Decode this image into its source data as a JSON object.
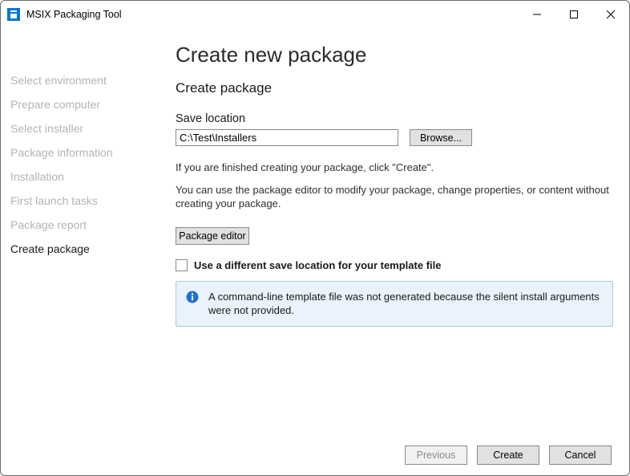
{
  "app": {
    "title": "MSIX Packaging Tool"
  },
  "sidebar": {
    "items": [
      {
        "label": "Select environment"
      },
      {
        "label": "Prepare computer"
      },
      {
        "label": "Select installer"
      },
      {
        "label": "Package information"
      },
      {
        "label": "Installation"
      },
      {
        "label": "First launch tasks"
      },
      {
        "label": "Package report"
      },
      {
        "label": "Create package"
      }
    ],
    "activeIndex": 7
  },
  "main": {
    "heading": "Create new package",
    "subheading": "Create package",
    "saveLocationLabel": "Save location",
    "saveLocationValue": "C:\\Test\\Installers",
    "browseLabel": "Browse...",
    "hint1": "If you are finished creating your package, click \"Create\".",
    "hint2": "You can use the package editor to modify your package, change properties, or content without creating your package.",
    "packageEditorLabel": "Package editor",
    "checkboxLabel": "Use a different save location for your template file",
    "infoMessage": "A command-line template file was not generated because the silent install arguments were not provided."
  },
  "footer": {
    "previousLabel": "Previous",
    "createLabel": "Create",
    "cancelLabel": "Cancel"
  }
}
